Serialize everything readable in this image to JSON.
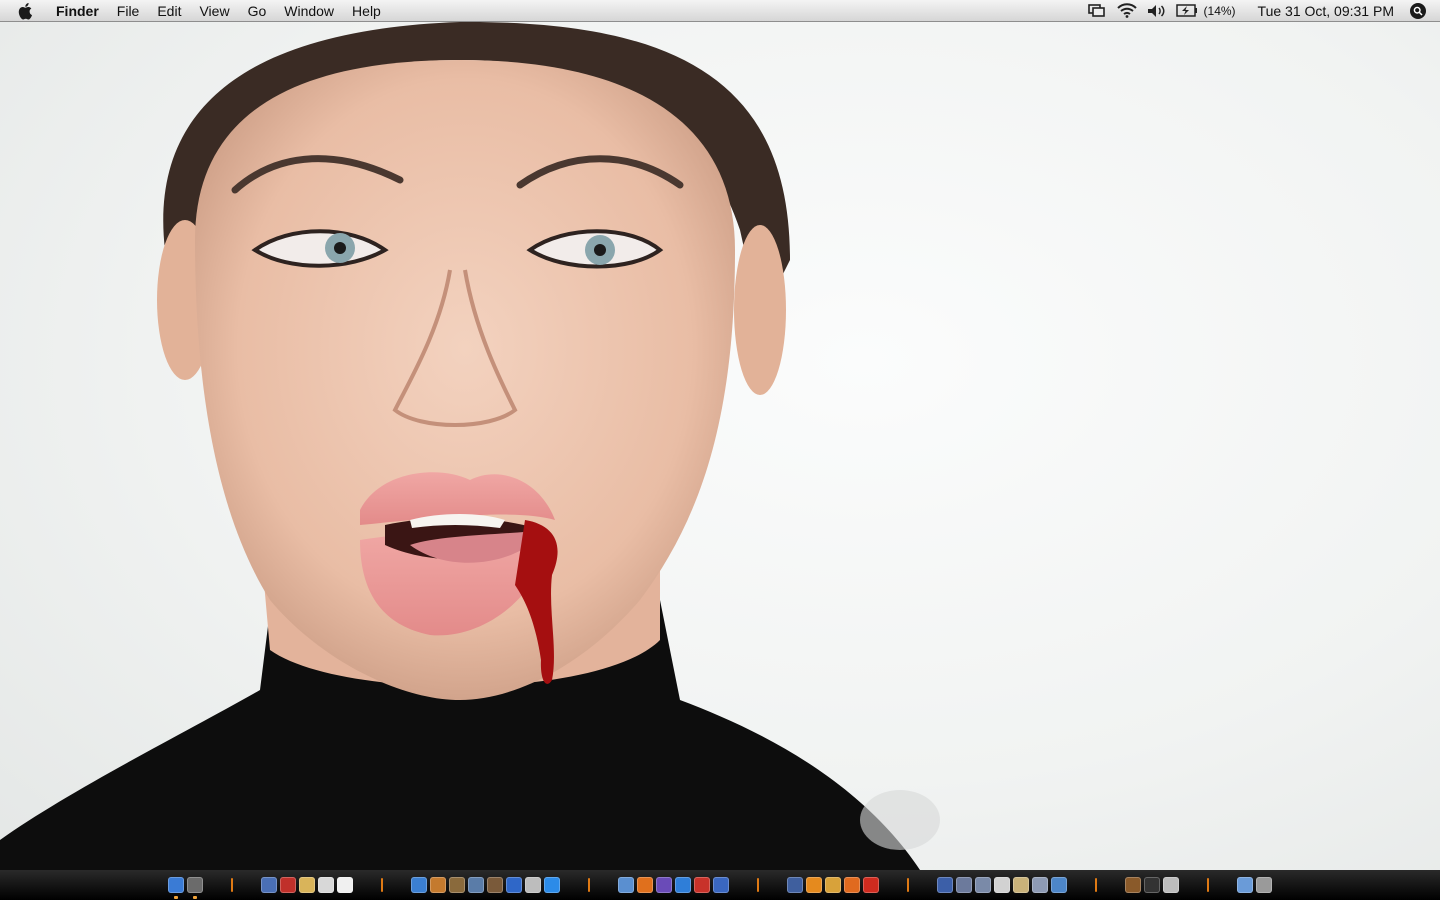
{
  "menubar": {
    "apple_icon": "apple-logo-icon",
    "app_name": "Finder",
    "menus": [
      "File",
      "Edit",
      "View",
      "Go",
      "Window",
      "Help"
    ],
    "status": {
      "display_icon": "display-mirroring-icon",
      "wifi_icon": "wifi-icon",
      "volume_icon": "volume-icon",
      "battery_icon": "battery-charging-icon",
      "battery_percent": "(14%)",
      "clock": "Tue 31 Oct, 09:31 PM",
      "spotlight_icon": "spotlight-icon"
    }
  },
  "desktop": {
    "wallpaper": "portrait-photo-wallpaper"
  },
  "dock": {
    "groups": [
      [
        {
          "name": "finder",
          "color": "#3a7bd5",
          "running": true
        },
        {
          "name": "dashboard",
          "color": "#6b6b6b",
          "running": true
        }
      ],
      [
        {
          "name": "preview",
          "color": "#4a6fb5"
        },
        {
          "name": "acrobat",
          "color": "#c0302a"
        },
        {
          "name": "stickies",
          "color": "#d9b45a"
        },
        {
          "name": "ical",
          "color": "#d8d8d8"
        },
        {
          "name": "textedit",
          "color": "#f0f0f0"
        }
      ],
      [
        {
          "name": "itunes",
          "color": "#3b7fd1"
        },
        {
          "name": "garageband",
          "color": "#c47a2e"
        },
        {
          "name": "iphoto",
          "color": "#8a6a3c"
        },
        {
          "name": "imovie",
          "color": "#5a7ca8"
        },
        {
          "name": "idvd",
          "color": "#7a5a3a"
        },
        {
          "name": "quicktime",
          "color": "#2f67c8"
        },
        {
          "name": "ipod",
          "color": "#bdbdbd"
        },
        {
          "name": "search",
          "color": "#2c8be8"
        }
      ],
      [
        {
          "name": "network",
          "color": "#5a8fd0"
        },
        {
          "name": "firefox",
          "color": "#e0701d"
        },
        {
          "name": "aim",
          "color": "#6a4bb8"
        },
        {
          "name": "internet-explorer",
          "color": "#2f7ed8"
        },
        {
          "name": "opera",
          "color": "#c8322a"
        },
        {
          "name": "mail",
          "color": "#3a67c0"
        }
      ],
      [
        {
          "name": "indesign",
          "color": "#3f5f9e"
        },
        {
          "name": "illustrator",
          "color": "#e58a1e"
        },
        {
          "name": "fireworks",
          "color": "#d8a23a"
        },
        {
          "name": "dreamweaver",
          "color": "#e06a1f"
        },
        {
          "name": "flash",
          "color": "#cf2b1f"
        }
      ],
      [
        {
          "name": "photo-booth",
          "color": "#3c5fa8"
        },
        {
          "name": "automator",
          "color": "#6c7a9c"
        },
        {
          "name": "script-editor",
          "color": "#7a8aa8"
        },
        {
          "name": "font-book",
          "color": "#d2d2d2"
        },
        {
          "name": "address-book",
          "color": "#c9b27a"
        },
        {
          "name": "system-profiler",
          "color": "#8e9bb5"
        },
        {
          "name": "network-utility",
          "color": "#4d86c8"
        }
      ],
      [
        {
          "name": "toolbox",
          "color": "#8a5a2a"
        },
        {
          "name": "terminal",
          "color": "#333333"
        },
        {
          "name": "activity-monitor",
          "color": "#bcbcbc"
        }
      ],
      [
        {
          "name": "applications",
          "color": "#6a9bd8"
        },
        {
          "name": "trash",
          "color": "#9a9a9a"
        }
      ]
    ]
  }
}
